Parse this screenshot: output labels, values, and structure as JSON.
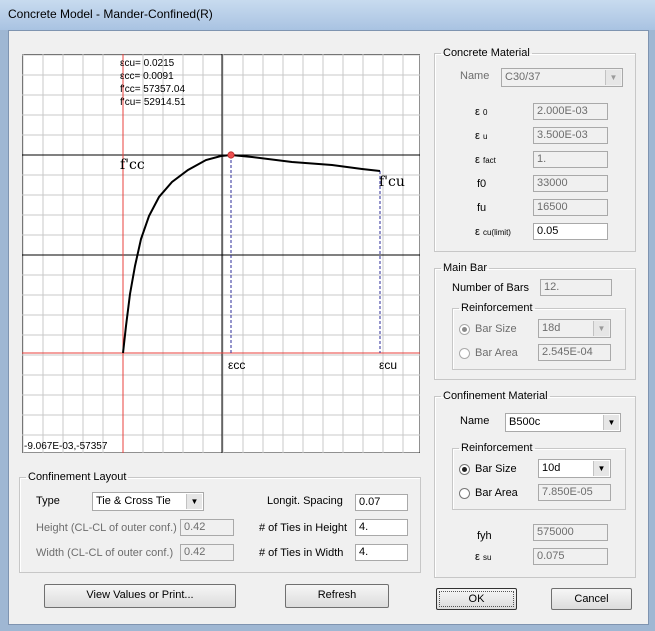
{
  "window": {
    "title": "Concrete Model - Mander-Confined(R)"
  },
  "plot": {
    "info": [
      "εcu= 0.0215",
      "εcc= 0.0091",
      "f'cc= 57357.04",
      "f'cu= 52914.51"
    ],
    "label_fcc": "f'cc",
    "label_fcu": "f'cu",
    "label_ecc": "εcc",
    "label_ecu": "εcu",
    "origin": "-9.067E-03,-57357"
  },
  "concrete_material": {
    "legend": "Concrete Material",
    "name_label": "Name",
    "name_value": "C30/37",
    "e0_label": "ε",
    "e0_sub": "0",
    "e0_value": "2.000E-03",
    "eu_label": "ε",
    "eu_sub": "u",
    "eu_value": "3.500E-03",
    "efact_label": "ε",
    "efact_sub": "fact",
    "efact_value": "1.",
    "f0_label": "f0",
    "f0_value": "33000",
    "fu_label": "fu",
    "fu_value": "16500",
    "ecul_label": "ε",
    "ecul_sub": "cu(limit)",
    "ecul_value": "0.05"
  },
  "main_bar": {
    "legend": "Main Bar",
    "nbars_label": "Number of Bars",
    "nbars_value": "12.",
    "reinf_legend": "Reinforcement",
    "size_label": "Bar Size",
    "size_value": "18d",
    "area_label": "Bar Area",
    "area_value": "2.545E-04"
  },
  "confinement_material": {
    "legend": "Confinement Material",
    "name_label": "Name",
    "name_value": "B500c",
    "reinf_legend": "Reinforcement",
    "size_label": "Bar Size",
    "size_value": "10d",
    "area_label": "Bar Area",
    "area_value": "7.850E-05",
    "fyh_label": "fyh",
    "fyh_value": "575000",
    "esu_label": "ε",
    "esu_sub": "su",
    "esu_value": "0.075"
  },
  "confinement_layout": {
    "legend": "Confinement Layout",
    "type_label": "Type",
    "type_value": "Tie & Cross Tie",
    "height_label": "Height (CL-CL of outer conf.)",
    "height_value": "0.42",
    "width_label": "Width (CL-CL of outer conf.)",
    "width_value": "0.42",
    "spacing_label": "Longit. Spacing",
    "spacing_value": "0.07",
    "ties_h_label": "# of Ties in Height",
    "ties_h_value": "4.",
    "ties_w_label": "# of Ties in Width",
    "ties_w_value": "4."
  },
  "buttons": {
    "view": "View Values or Print...",
    "refresh": "Refresh",
    "ok": "OK",
    "cancel": "Cancel"
  },
  "colors": {
    "axis_red": "#e8403c",
    "curve": "#000000",
    "dashed": "#2b2b9a",
    "grid": "#c8c8c8"
  }
}
